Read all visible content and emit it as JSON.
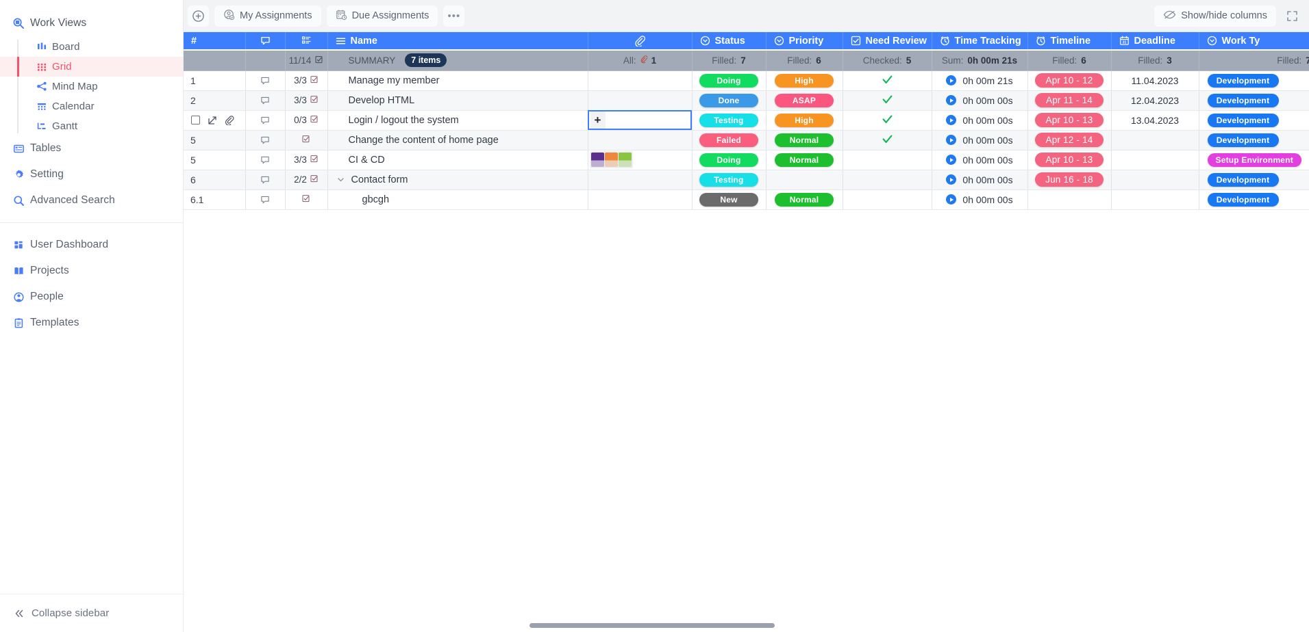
{
  "sidebar": {
    "groups": [
      {
        "label": "Work Views",
        "icon": "work-views-icon",
        "items": [
          {
            "label": "Board",
            "icon": "board-icon",
            "active": false
          },
          {
            "label": "Grid",
            "icon": "grid-icon",
            "active": true
          },
          {
            "label": "Mind Map",
            "icon": "mind-map-icon",
            "active": false
          },
          {
            "label": "Calendar",
            "icon": "calendar-icon",
            "active": false
          },
          {
            "label": "Gantt",
            "icon": "gantt-icon",
            "active": false
          }
        ]
      }
    ],
    "top_items": [
      {
        "label": "Tables",
        "icon": "tables-icon"
      },
      {
        "label": "Setting",
        "icon": "gear-icon"
      },
      {
        "label": "Advanced Search",
        "icon": "search-icon"
      }
    ],
    "bottom_items": [
      {
        "label": "User Dashboard",
        "icon": "dashboard-icon"
      },
      {
        "label": "Projects",
        "icon": "book-icon"
      },
      {
        "label": "People",
        "icon": "person-icon"
      },
      {
        "label": "Templates",
        "icon": "clipboard-icon"
      }
    ],
    "collapse_label": "Collapse sidebar"
  },
  "toolbar": {
    "add_label": "",
    "my_assignments": "My Assignments",
    "due_assignments": "Due Assignments",
    "more_label": "•••",
    "show_hide_columns": "Show/hide columns"
  },
  "grid": {
    "columns": [
      {
        "key": "num",
        "label": "#",
        "icon": null
      },
      {
        "key": "comment",
        "label": "",
        "icon": "comment-icon"
      },
      {
        "key": "subtask",
        "label": "",
        "icon": "checklist-icon"
      },
      {
        "key": "name",
        "label": "Name",
        "icon": "menu-icon"
      },
      {
        "key": "attachment",
        "label": "",
        "icon": "paperclip-icon"
      },
      {
        "key": "status",
        "label": "Status",
        "icon": "dropdown-circle-icon"
      },
      {
        "key": "priority",
        "label": "Priority",
        "icon": "dropdown-circle-icon"
      },
      {
        "key": "need_review",
        "label": "Need Review",
        "icon": "checkbox-icon"
      },
      {
        "key": "time_tracking",
        "label": "Time Tracking",
        "icon": "clock-icon"
      },
      {
        "key": "timeline",
        "label": "Timeline",
        "icon": "clock-icon"
      },
      {
        "key": "deadline",
        "label": "Deadline",
        "icon": "calendar31-icon"
      },
      {
        "key": "work_type",
        "label": "Work Ty",
        "icon": "dropdown-circle-icon"
      }
    ],
    "summary": {
      "subtask": "11/14",
      "name_label": "SUMMARY",
      "name_count": "7 items",
      "attachment": "All:",
      "attachment_value": "1",
      "status_label": "Filled:",
      "status_value": "7",
      "priority_label": "Filled:",
      "priority_value": "6",
      "need_review_label": "Checked:",
      "need_review_value": "5",
      "time_label": "Sum:",
      "time_value": "0h 00m 21s",
      "timeline_label": "Filled:",
      "timeline_value": "6",
      "deadline_label": "Filled:",
      "deadline_value": "3",
      "work_type_label": "Filled:",
      "work_type_value": "7"
    },
    "rows": [
      {
        "num": "1",
        "subtask": "3/3",
        "name": "Manage my member",
        "indent": 0,
        "attachment": null,
        "status": "Doing",
        "status_color": "#12dc60",
        "priority": "High",
        "priority_color": "#f89522",
        "need_review": true,
        "time": "0h 00m 21s",
        "timeline": "Apr 10 - 12",
        "timeline_color": "#f4637f",
        "deadline": "11.04.2023",
        "work_type": "Development",
        "work_type_color": "#1877f2",
        "hovered": false,
        "selected": false,
        "collapsible": false
      },
      {
        "num": "2",
        "subtask": "3/3",
        "name": "Develop HTML",
        "indent": 0,
        "attachment": null,
        "status": "Done",
        "status_color": "#3a9ae8",
        "priority": "ASAP",
        "priority_color": "#fb567f",
        "need_review": true,
        "time": "0h 00m 00s",
        "timeline": "Apr 11 - 14",
        "timeline_color": "#f4637f",
        "deadline": "12.04.2023",
        "work_type": "Development",
        "work_type_color": "#1877f2",
        "hovered": false,
        "selected": false,
        "collapsible": false
      },
      {
        "num": "",
        "subtask": "0/3",
        "name": "Login / logout the system",
        "indent": 0,
        "attachment": "plus",
        "status": "Testing",
        "status_color": "#16dfe8",
        "priority": "High",
        "priority_color": "#f89522",
        "need_review": true,
        "time": "0h 00m 00s",
        "timeline": "Apr 10 - 13",
        "timeline_color": "#f4637f",
        "deadline": "13.04.2023",
        "work_type": "Development",
        "work_type_color": "#1877f2",
        "hovered": true,
        "selected": true,
        "collapsible": false
      },
      {
        "num": "5",
        "subtask": "",
        "name": "Change the content of home page",
        "indent": 0,
        "attachment": null,
        "status": "Failed",
        "status_color": "#fb5d7e",
        "priority": "Normal",
        "priority_color": "#1dbf2e",
        "need_review": true,
        "time": "0h 00m 00s",
        "timeline": "Apr 12 - 14",
        "timeline_color": "#f4637f",
        "deadline": "",
        "work_type": "Development",
        "work_type_color": "#1877f2",
        "hovered": false,
        "selected": false,
        "collapsible": false
      },
      {
        "num": "5",
        "subtask": "3/3",
        "name": "CI & CD",
        "indent": 0,
        "attachment": "thumbs",
        "status": "Doing",
        "status_color": "#12dc60",
        "priority": "Normal",
        "priority_color": "#1dbf2e",
        "need_review": false,
        "time": "0h 00m 00s",
        "timeline": "Apr 10 - 13",
        "timeline_color": "#f4637f",
        "deadline": "",
        "work_type": "Setup Environment",
        "work_type_color": "#e23ee0",
        "hovered": false,
        "selected": false,
        "collapsible": false
      },
      {
        "num": "6",
        "subtask": "2/2",
        "name": "Contact form",
        "indent": 0,
        "attachment": null,
        "status": "Testing",
        "status_color": "#16dfe8",
        "priority": "",
        "priority_color": "",
        "need_review": false,
        "time": "0h 00m 00s",
        "timeline": "Jun 16 - 18",
        "timeline_color": "#f4637f",
        "deadline": "",
        "work_type": "Development",
        "work_type_color": "#1877f2",
        "hovered": false,
        "selected": false,
        "collapsible": true
      },
      {
        "num": "6.1",
        "subtask": "",
        "name": "gbcgh",
        "indent": 1,
        "attachment": null,
        "status": "New",
        "status_color": "#6b6b6b",
        "priority": "Normal",
        "priority_color": "#1dbf2e",
        "need_review": false,
        "time": "0h 00m 00s",
        "timeline": "",
        "timeline_color": "",
        "deadline": "",
        "work_type": "Development",
        "work_type_color": "#1877f2",
        "hovered": false,
        "selected": false,
        "collapsible": false
      }
    ],
    "thumbnail_colors": [
      "#5b2d8e",
      "#f0863c",
      "#8bc540"
    ],
    "check_color": "#12b75a"
  },
  "theme": {
    "header_blue": "#3c7efc",
    "summary_gray": "#a2a9b7",
    "active_red": "#f4526a",
    "icon_blue": "#4a7dfc"
  }
}
